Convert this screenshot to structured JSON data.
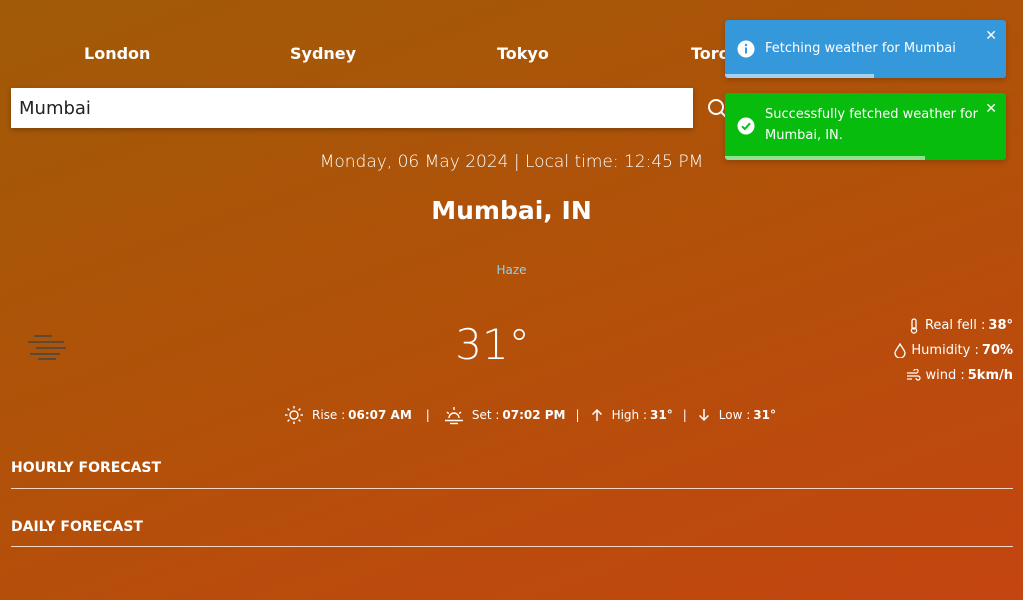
{
  "cities": [
    "London",
    "Sydney",
    "Tokyo",
    "Toronto"
  ],
  "search": {
    "value": "Mumbai"
  },
  "datetime": "Monday, 06 May 2024 | Local time: 12:45 PM",
  "location": "Mumbai, IN",
  "condition": "Haze",
  "temperature": "31°",
  "details": {
    "real_feel_label": "Real fell :",
    "real_feel": "38°",
    "humidity_label": "Humidity :",
    "humidity": "70%",
    "wind_label": "wind :",
    "wind": "5km/h"
  },
  "sun": {
    "rise_label": "Rise :",
    "rise": "06:07 AM",
    "set_label": "Set :",
    "set": "07:02 PM",
    "high_label": "High :",
    "high": "31°",
    "low_label": "Low :",
    "low": "31°",
    "separator": "|"
  },
  "sections": {
    "hourly": "HOURLY FORECAST",
    "daily": "DAILY FORECAST"
  },
  "toasts": [
    {
      "message": "Fetching weather for Mumbai",
      "color": "#3598db",
      "progress": 0.53
    },
    {
      "message": "Successfully fetched weather for Mumbai, IN.",
      "color": "#07bc0c",
      "progress": 0.71
    }
  ],
  "colors": {
    "condition_text": "#8fd3e8",
    "info_toast": "#3598db",
    "success_toast": "#07bc0c"
  },
  "icons": [
    "search-icon",
    "haze-icon",
    "thermometer-icon",
    "droplet-icon",
    "wind-icon",
    "sunrise-icon",
    "sunset-icon",
    "arrow-up-icon",
    "arrow-down-icon",
    "info-icon",
    "check-circle-icon",
    "close-icon"
  ]
}
